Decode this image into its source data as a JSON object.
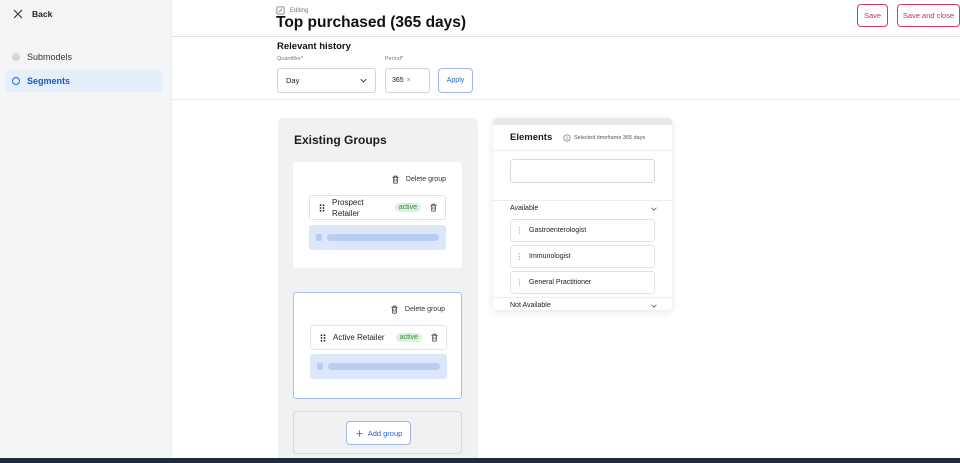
{
  "sidebar": {
    "back_label": "Back",
    "items": [
      {
        "label": "Submodels"
      },
      {
        "label": "Segments"
      }
    ]
  },
  "header": {
    "editing_label": "Editing",
    "title": "Top purchased (365 days)",
    "save_label": "Save",
    "save_close_label": "Save and close"
  },
  "history": {
    "title": "Relevant history",
    "quantifier_label": "Quantifier*",
    "quantifier_value": "Day",
    "period_label": "Period*",
    "period_value": "365",
    "period_clear": "×",
    "apply_label": "Apply"
  },
  "groups": {
    "title": "Existing Groups",
    "delete_label": "Delete group",
    "items": [
      {
        "member": "Prospect Retailer",
        "status": "active"
      },
      {
        "member": "Active Retailer",
        "status": "active"
      }
    ],
    "add_label": "Add group"
  },
  "elements": {
    "title": "Elements",
    "timeframe": "Selected timeframe 365 days",
    "search_placeholder": "",
    "available_label": "Available",
    "available_items": [
      "Gastroenterologist",
      "Immunologist",
      "General Practitioner"
    ],
    "not_available_label": "Not Available"
  },
  "colors": {
    "accent": "#c0335e",
    "primary": "#2a64c7",
    "active_badge_bg": "#d9f2dc",
    "active_badge_text": "#2f8a3c"
  }
}
